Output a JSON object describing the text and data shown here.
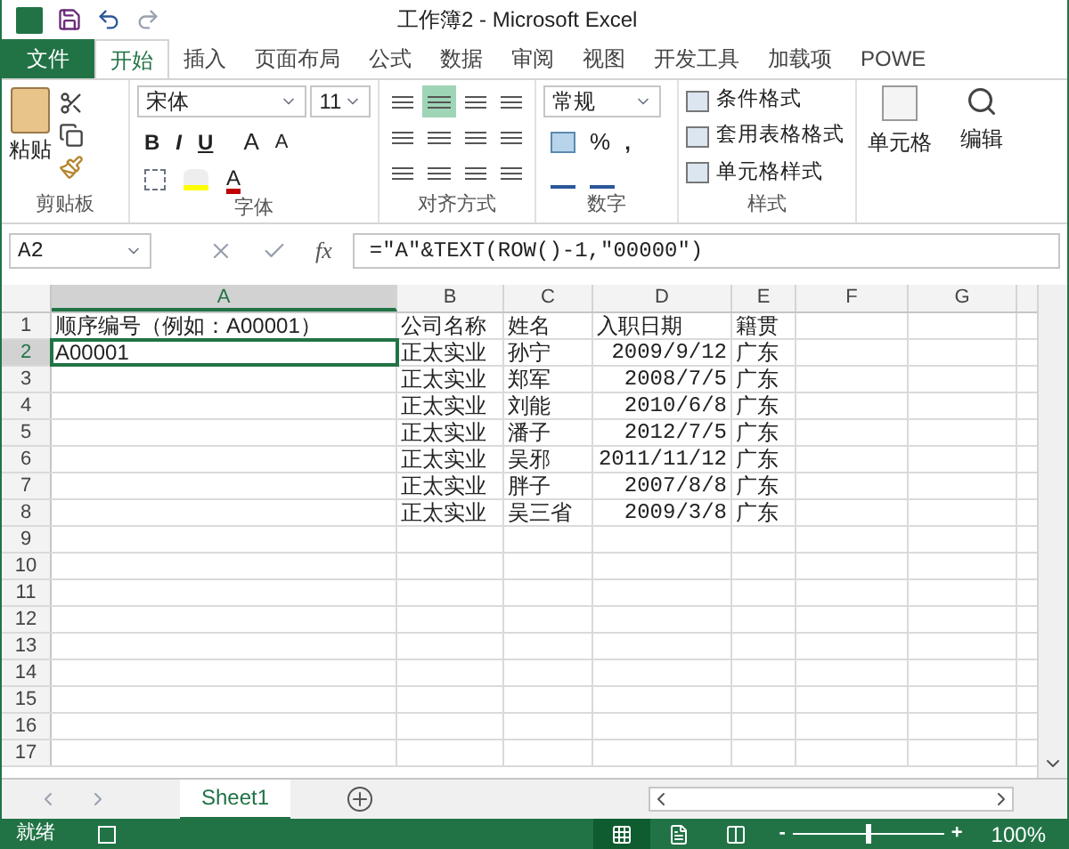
{
  "title_bar": {
    "title": "工作簿2 - Microsoft Excel"
  },
  "ribbon_tabs": [
    {
      "label": "文件",
      "kind": "file",
      "selected": false
    },
    {
      "label": "开始",
      "kind": "tab",
      "selected": true
    },
    {
      "label": "插入",
      "kind": "tab",
      "selected": false
    },
    {
      "label": "页面布局",
      "kind": "tab",
      "selected": false
    },
    {
      "label": "公式",
      "kind": "tab",
      "selected": false
    },
    {
      "label": "数据",
      "kind": "tab",
      "selected": false
    },
    {
      "label": "审阅",
      "kind": "tab",
      "selected": false
    },
    {
      "label": "视图",
      "kind": "tab",
      "selected": false
    },
    {
      "label": "开发工具",
      "kind": "tab",
      "selected": false
    },
    {
      "label": "加载项",
      "kind": "tab",
      "selected": false
    },
    {
      "label": "POWE",
      "kind": "tab",
      "selected": false
    }
  ],
  "ribbon": {
    "paste": "粘贴",
    "font_name": "宋体",
    "font_size": "11",
    "bold": "B",
    "italic": "I",
    "underline": "U",
    "grow_font": "A",
    "shrink_font": "A",
    "font_color": "A",
    "align_center_selected": true,
    "number_format": "常规",
    "percent": "%",
    "comma": ",",
    "style_commands": [
      "条件格式",
      "套用表格格式",
      "单元格样式"
    ],
    "cells": "单元格",
    "editing": "编辑",
    "group_labels": [
      "剪贴板",
      "字体",
      "对齐方式",
      "数字",
      "样式"
    ]
  },
  "formula_bar": {
    "name_box": "A2",
    "fx": "fx",
    "formula": "=\"A\"&TEXT(ROW()-1,\"00000\")"
  },
  "columns": [
    {
      "label": "A",
      "selected": true
    },
    {
      "label": "B",
      "selected": false
    },
    {
      "label": "C",
      "selected": false
    },
    {
      "label": "D",
      "selected": false
    },
    {
      "label": "E",
      "selected": false
    },
    {
      "label": "F",
      "selected": false
    },
    {
      "label": "G",
      "selected": false
    }
  ],
  "rows": [
    {
      "number": "1",
      "selected": false,
      "kind": "header",
      "a": "顺序编号（例如：A00001）",
      "b": "公司名称",
      "c": "姓名",
      "d": "入职日期",
      "e": "籍贯"
    },
    {
      "number": "2",
      "selected": true,
      "kind": "record",
      "a": "A00001",
      "b": "正太实业",
      "c": "孙宁",
      "d": "2009/9/12",
      "e": "广东"
    },
    {
      "number": "3",
      "selected": false,
      "kind": "record",
      "b": "正太实业",
      "c": "郑军",
      "d": "2008/7/5",
      "e": "广东"
    },
    {
      "number": "4",
      "selected": false,
      "kind": "record",
      "b": "正太实业",
      "c": "刘能",
      "d": "2010/6/8",
      "e": "广东"
    },
    {
      "number": "5",
      "selected": false,
      "kind": "record",
      "b": "正太实业",
      "c": "潘子",
      "d": "2012/7/5",
      "e": "广东"
    },
    {
      "number": "6",
      "selected": false,
      "kind": "record",
      "b": "正太实业",
      "c": "吴邪",
      "d": "2011/11/12",
      "e": "广东"
    },
    {
      "number": "7",
      "selected": false,
      "kind": "record",
      "b": "正太实业",
      "c": "胖子",
      "d": "2007/8/8",
      "e": "广东"
    },
    {
      "number": "8",
      "selected": false,
      "kind": "record",
      "b": "正太实业",
      "c": "吴三省",
      "d": "2009/3/8",
      "e": "广东"
    },
    {
      "number": "9",
      "selected": false,
      "kind": "empty"
    },
    {
      "number": "10",
      "selected": false,
      "kind": "empty"
    },
    {
      "number": "11",
      "selected": false,
      "kind": "empty"
    },
    {
      "number": "12",
      "selected": false,
      "kind": "empty"
    },
    {
      "number": "13",
      "selected": false,
      "kind": "empty"
    },
    {
      "number": "14",
      "selected": false,
      "kind": "empty"
    },
    {
      "number": "15",
      "selected": false,
      "kind": "empty"
    },
    {
      "number": "16",
      "selected": false,
      "kind": "empty"
    },
    {
      "number": "17",
      "selected": false,
      "kind": "empty"
    }
  ],
  "sheet_tabs": [
    {
      "label": "Sheet1",
      "selected": true
    }
  ],
  "status_bar": {
    "status": "就绪",
    "views": [
      {
        "kind": "normal",
        "selected": true
      },
      {
        "kind": "layout",
        "selected": false
      },
      {
        "kind": "pagebreak",
        "selected": false
      }
    ],
    "zoom_minus": "-",
    "zoom_plus": "+",
    "level": 0.5,
    "zoom": "100%"
  }
}
